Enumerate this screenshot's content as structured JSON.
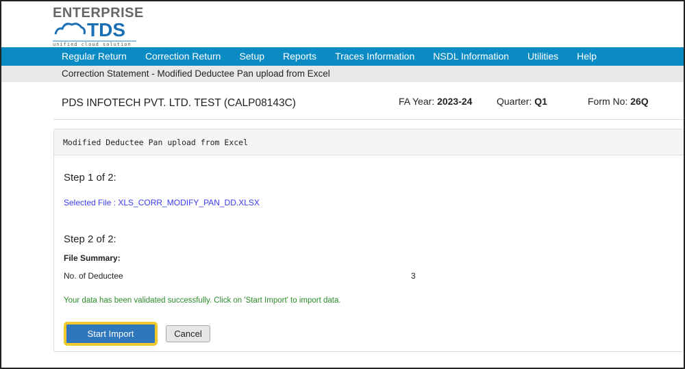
{
  "logo": {
    "line1": "ENTERPRISE",
    "line2": "TDS",
    "tagline": "unified cloud solution"
  },
  "nav": [
    "Regular Return",
    "Correction Return",
    "Setup",
    "Reports",
    "Traces Information",
    "NSDL Information",
    "Utilities",
    "Help"
  ],
  "breadcrumb": "Correction Statement - Modified Deductee Pan upload from Excel",
  "header": {
    "company": "PDS INFOTECH PVT. LTD. TEST (CALP08143C)",
    "fa_label": "FA Year:",
    "fa_value": "2023-24",
    "q_label": "Quarter:",
    "q_value": "Q1",
    "form_label": "Form No:",
    "form_value": "26Q"
  },
  "panel": {
    "title": "Modified Deductee Pan upload from Excel",
    "step1": "Step 1 of 2:",
    "selected_file": "Selected File : XLS_CORR_MODIFY_PAN_DD.XLSX",
    "step2": "Step 2 of 2:",
    "summary_label": "File Summary:",
    "deductee_label": "No. of Deductee",
    "deductee_count": "3",
    "message": "Your data has been validated successfully. Click on 'Start Import' to import data.",
    "start_import": "Start Import",
    "cancel": "Cancel"
  }
}
